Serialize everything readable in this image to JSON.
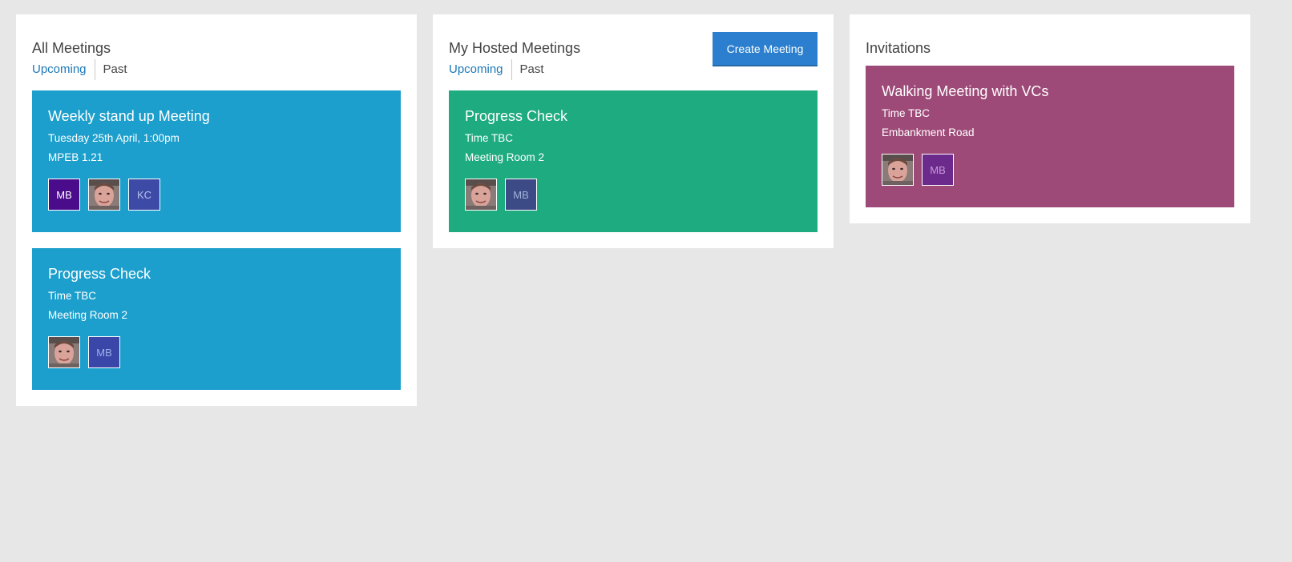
{
  "colors": {
    "blue_card": "#1c9fcc",
    "green_card": "#1fab80",
    "purple_card": "#9e4a78",
    "tab_active": "#1b78b8",
    "button": "#2c7fce"
  },
  "all_meetings": {
    "title": "All Meetings",
    "tabs": [
      {
        "label": "Upcoming"
      },
      {
        "label": "Past"
      }
    ],
    "cards": [
      {
        "title": "Weekly stand up Meeting",
        "time": "Tuesday 25th April, 1:00pm",
        "location": "MPEB 1.21",
        "avatars": [
          {
            "initials": "MB",
            "bg": "#4b0c8c",
            "fg": "#ffffff"
          },
          {
            "type": "photo"
          },
          {
            "initials": "KC",
            "bg": "#3d4aa6",
            "fg": "#b8c0ea"
          }
        ]
      },
      {
        "title": "Progress Check",
        "time": "Time TBC",
        "location": "Meeting Room 2",
        "avatars": [
          {
            "type": "photo"
          },
          {
            "initials": "MB",
            "bg": "#3a46a8",
            "fg": "#9fb0e6"
          }
        ]
      }
    ]
  },
  "hosted_meetings": {
    "title": "My Hosted Meetings",
    "create_label": "Create Meeting",
    "tabs": [
      {
        "label": "Upcoming"
      },
      {
        "label": "Past"
      }
    ],
    "cards": [
      {
        "title": "Progress Check",
        "time": "Time TBC",
        "location": "Meeting Room 2",
        "avatars": [
          {
            "type": "photo"
          },
          {
            "initials": "MB",
            "bg": "#3c4a86",
            "fg": "#9fb4d8"
          }
        ]
      }
    ]
  },
  "invitations": {
    "title": "Invitations",
    "cards": [
      {
        "title": "Walking Meeting with VCs",
        "time": "Time TBC",
        "location": "Embankment Road",
        "avatars": [
          {
            "type": "photo"
          },
          {
            "initials": "MB",
            "bg": "#6c2a8c",
            "fg": "#c79ad8"
          }
        ]
      }
    ]
  }
}
